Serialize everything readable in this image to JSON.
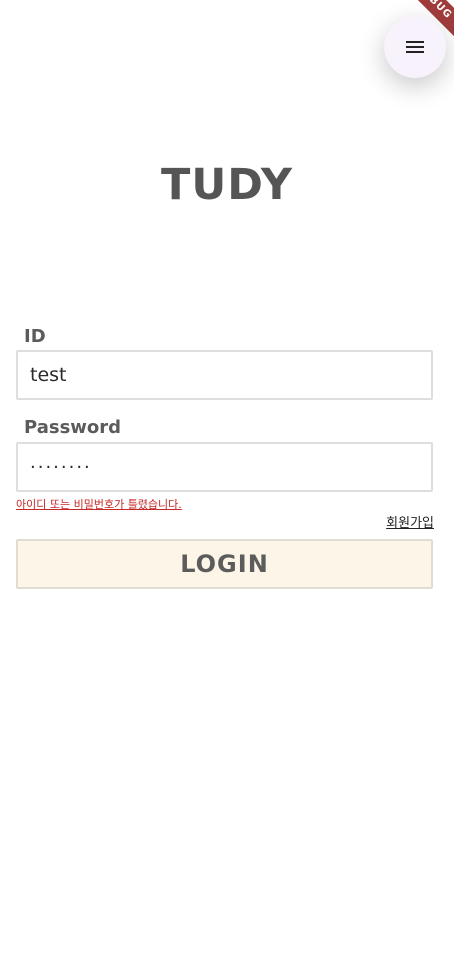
{
  "debug_banner": "DEBUG",
  "app_title": "TUDY",
  "menu_icon": "menu-icon",
  "id_field": {
    "label": "ID",
    "value": "test"
  },
  "password_field": {
    "label": "Password",
    "masked_value": "········"
  },
  "error_message": "아이디 또는 비밀번호가 틀렸습니다.",
  "signup_link": "회원가입",
  "login_button": "LOGIN",
  "colors": {
    "accent": "#fdf5e7",
    "error": "#c62828",
    "fab": "#f7f2fb"
  }
}
